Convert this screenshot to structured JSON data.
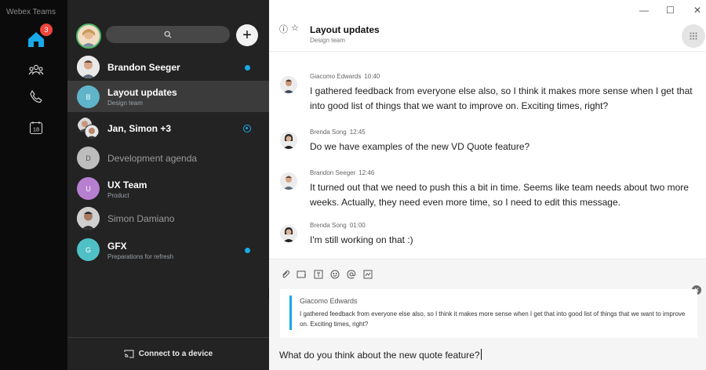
{
  "window": {
    "app_title": "Webex Teams"
  },
  "rail": {
    "home_badge": "3",
    "calendar_day": "18"
  },
  "spaces": {
    "items": [
      {
        "title": "Brandon Seeger",
        "subtitle": "",
        "initial": "",
        "unread": "dot"
      },
      {
        "title": "Layout updates",
        "subtitle": "Design team",
        "initial": "B",
        "selected": true
      },
      {
        "title": "Jan, Simon +3",
        "subtitle": "",
        "initial": "",
        "unread": "ring"
      },
      {
        "title": "Development agenda",
        "subtitle": "",
        "initial": "D",
        "muted": true
      },
      {
        "title": "UX Team",
        "subtitle": "Product",
        "initial": "U"
      },
      {
        "title": "Simon Damiano",
        "subtitle": "",
        "initial": "",
        "muted": true
      },
      {
        "title": "GFX",
        "subtitle": "Preparations for refresh",
        "initial": "G",
        "unread": "dot"
      }
    ],
    "connect_label": "Connect to a device"
  },
  "space_header": {
    "title": "Layout updates",
    "subtitle": "Design team"
  },
  "messages": [
    {
      "author": "Giacomo Edwards",
      "time": "10:40",
      "text": "I gathered feedback from everyone else also, so I think it makes more sense when I get that into good list of things that we want to improve on. Exciting times, right?"
    },
    {
      "author": "Brenda Song",
      "time": "12:45",
      "text": "Do we have examples of the new VD Quote feature?"
    },
    {
      "author": "Brandon Seeger",
      "time": "12:46",
      "text": "It turned out that we need to push this a bit in time. Seems like team needs about two more weeks. Actually, they need even more time, so I need to edit this message."
    },
    {
      "author": "Brenda Song",
      "time": "01:00",
      "text": "I'm still working on that :)"
    }
  ],
  "composer": {
    "quote_author": "Giacomo Edwards",
    "quote_text": "I gathered feedback from everyone else also, so I think it makes more sense when I get that into good list of things that we want to improve on. Exciting times, right?",
    "draft": "What do you think about the new quote feature?"
  },
  "colors": {
    "accent": "#18a9e8",
    "badge": "#f0463c",
    "presence": "#4dbb6a"
  }
}
